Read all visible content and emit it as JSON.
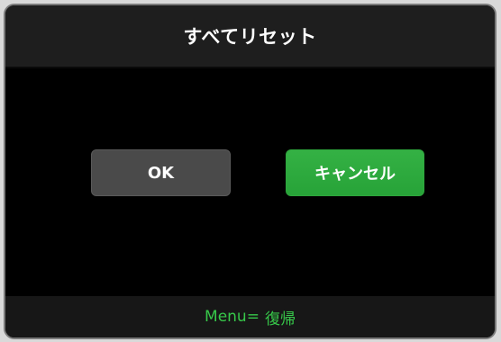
{
  "dialog": {
    "title": "すべてリセット"
  },
  "buttons": {
    "ok_label": "OK",
    "cancel_label": "キャンセル"
  },
  "footer": {
    "hint_key": "Menu=",
    "hint_action": "復帰"
  },
  "colors": {
    "accent_green": "#2aa83a",
    "footer_text": "#37c84a",
    "ok_button": "#4a4a4a",
    "dialog_bg": "#000000",
    "titlebar_bg": "#1e1e1e"
  }
}
